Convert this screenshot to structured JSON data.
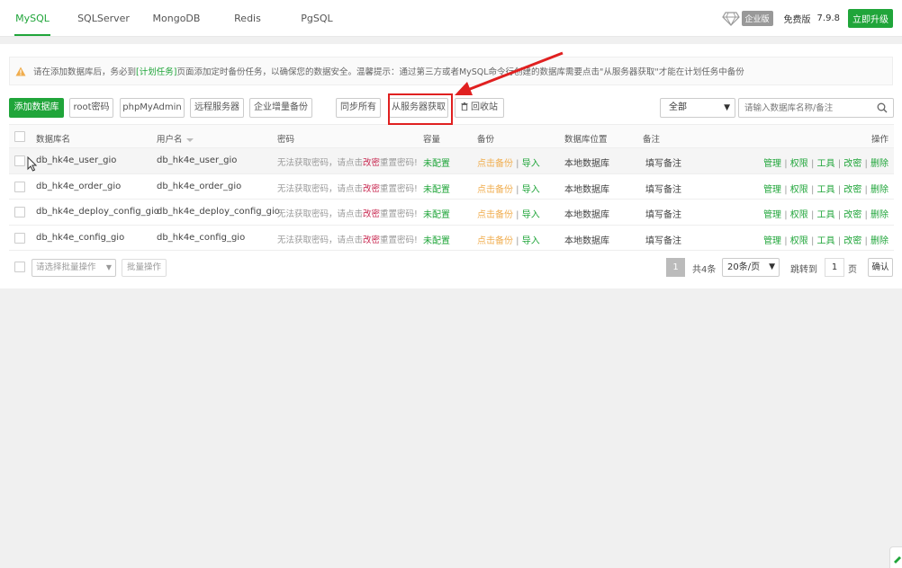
{
  "tabs": [
    "MySQL",
    "SQLServer",
    "MongoDB",
    "Redis",
    "PgSQL"
  ],
  "top_right": {
    "enterprise_badge": "企业版",
    "free_label": "免费版",
    "version": "7.9.8",
    "upgrade_label": "立即升级"
  },
  "warning": {
    "icon": "warning-triangle-icon",
    "text_before": "请在添加数据库后，务必到",
    "link": "[计划任务]",
    "text_after": "页面添加定时备份任务，以确保您的数据安全。温馨提示：通过第三方或者MySQL命令行创建的数据库需要点击\"从服务器获取\"才能在计划任务中备份"
  },
  "toolbar": {
    "add_db": "添加数据库",
    "root_pw": "root密码",
    "phpmyadmin": "phpMyAdmin",
    "remote_server": "远程服务器",
    "enterprise_backup": "企业增量备份",
    "sync_all": "同步所有",
    "fetch_from_server": "从服务器获取",
    "recycle_bin": "回收站",
    "filter_value": "全部",
    "search_placeholder": "请输入数据库名称/备注"
  },
  "columns": {
    "name": "数据库名",
    "user": "用户名",
    "password": "密码",
    "capacity": "容量",
    "backup": "备份",
    "location": "数据库位置",
    "note": "备注",
    "actions": "操作"
  },
  "rows": [
    {
      "name": "db_hk4e_user_gio",
      "user": "db_hk4e_user_gio",
      "capacity": "未配置",
      "location": "本地数据库",
      "note": "填写备注"
    },
    {
      "name": "db_hk4e_order_gio",
      "user": "db_hk4e_order_gio",
      "capacity": "未配置",
      "location": "本地数据库",
      "note": "填写备注"
    },
    {
      "name": "db_hk4e_deploy_config_gio",
      "user": "db_hk4e_deploy_config_gio",
      "capacity": "未配置",
      "location": "本地数据库",
      "note": "填写备注"
    },
    {
      "name": "db_hk4e_config_gio",
      "user": "db_hk4e_config_gio",
      "capacity": "未配置",
      "location": "本地数据库",
      "note": "填写备注"
    }
  ],
  "password_text": {
    "before": "无法获取密码，请点击",
    "red": "改密",
    "after": "重置密码!"
  },
  "backup_text": {
    "backup": "点击备份",
    "import": "导入"
  },
  "row_actions": [
    "管理",
    "权限",
    "工具",
    "改密",
    "删除"
  ],
  "bottom": {
    "batch_placeholder": "请选择批量操作",
    "batch_btn": "批量操作",
    "current_page": "1",
    "total": "共4条",
    "page_size": "20条/页",
    "jump_to": "跳转到",
    "page_input": "1",
    "page_unit": "页",
    "confirm": "确认"
  },
  "colors": {
    "accent": "#20a53a",
    "annotation_red": "#e02020"
  }
}
